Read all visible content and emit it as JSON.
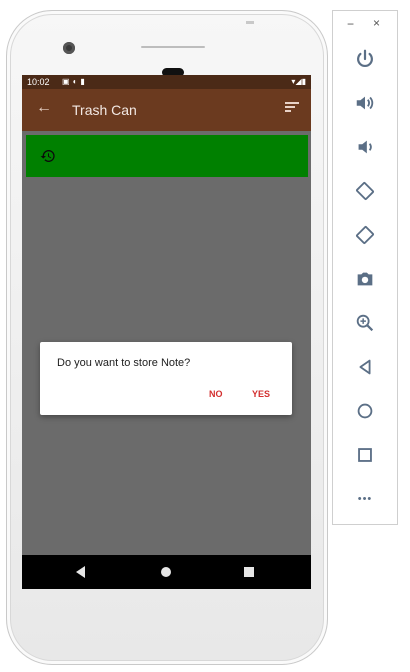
{
  "status_bar": {
    "time": "10:02",
    "left_icons": [
      "calendar-icon",
      "sync-icon",
      "sd-card-icon"
    ],
    "right_icons": [
      "wifi-icon",
      "signal-icon",
      "battery-icon"
    ]
  },
  "app_bar": {
    "title": "Trash Can"
  },
  "dialog": {
    "message": "Do you want to store Note?",
    "no_label": "NO",
    "yes_label": "YES"
  },
  "emulator_toolbar": {
    "minimize_label": "−",
    "close_label": "×",
    "more_label": "•••",
    "buttons": [
      "power",
      "volume-up",
      "volume-down",
      "rotate-left",
      "rotate-right",
      "screenshot",
      "zoom",
      "back",
      "home",
      "overview"
    ]
  },
  "colors": {
    "status_bar": "#4b2a17",
    "app_bar": "#6b3a1f",
    "screen_bg": "#6b6b6b",
    "list_item_bg": "#008000",
    "dialog_button": "#d32f2f",
    "emulator_icon": "#5b6f86"
  }
}
